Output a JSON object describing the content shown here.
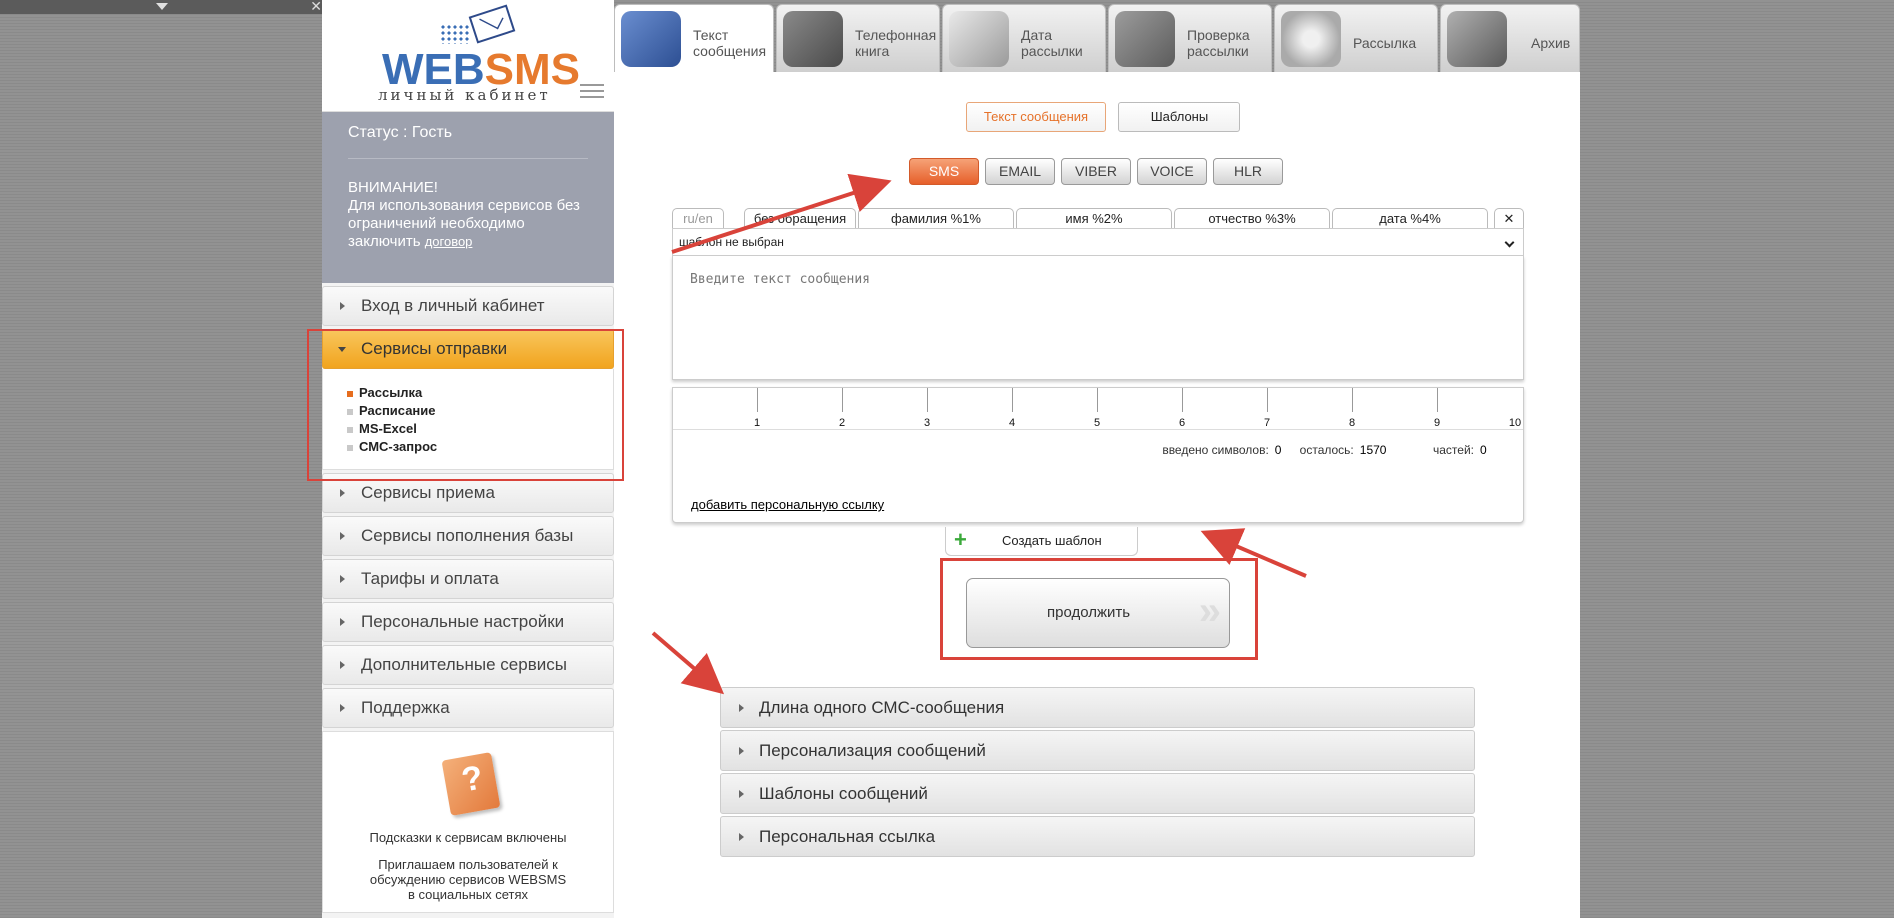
{
  "brand": {
    "logo_web": "WEB",
    "logo_sms": "SMS",
    "subtitle": "личный кабинет"
  },
  "status": {
    "text": "Статус : Гость"
  },
  "notice": {
    "title": "ВНИМАНИЕ!",
    "text": "Для использования сервисов без ограничений необходимо заключить",
    "link": "договор"
  },
  "sidebar": {
    "items": [
      {
        "label": "Вход в личный кабинет"
      },
      {
        "label": "Сервисы отправки"
      },
      {
        "label": "Сервисы приема"
      },
      {
        "label": "Сервисы пополнения базы"
      },
      {
        "label": "Тарифы и оплата"
      },
      {
        "label": "Персональные настройки"
      },
      {
        "label": "Дополнительные сервисы"
      },
      {
        "label": "Поддержка"
      }
    ],
    "submenu": [
      "Рассылка",
      "Расписание",
      "MS-Excel",
      "СМС-запрос"
    ]
  },
  "hints": {
    "enabled": "Подсказки к сервисам включены",
    "invite": "Приглашаем пользователей к обсуждению сервисов WEBSMS в социальных сетях"
  },
  "top_tabs": [
    {
      "label": "Текст сообщения",
      "icon": "keyboard-icon"
    },
    {
      "label": "Телефонная книга",
      "icon": "phone-book-icon"
    },
    {
      "label": "Дата рассылки",
      "icon": "calendar-clock-icon"
    },
    {
      "label": "Проверка рассылки",
      "icon": "price-check-icon"
    },
    {
      "label": "Рассылка",
      "icon": "disc-icon"
    },
    {
      "label": "Архив",
      "icon": "archive-box-icon"
    }
  ],
  "mode_buttons": {
    "text": "Текст сообщения",
    "templates": "Шаблоны"
  },
  "channels": [
    "SMS",
    "EMAIL",
    "VIBER",
    "VOICE",
    "HLR"
  ],
  "variables": {
    "ruen": "ru/en",
    "tabs": [
      "без обращения",
      "фамилия %1%",
      "имя %2%",
      "отчество %3%",
      "дата %4%"
    ],
    "close": "✕"
  },
  "template_select": {
    "value": "шаблон не выбран"
  },
  "message": {
    "placeholder": "Введите текст сообщения"
  },
  "ruler": [
    "1",
    "2",
    "3",
    "4",
    "5",
    "6",
    "7",
    "8",
    "9",
    "10"
  ],
  "counters": {
    "entered_label": "введено символов:",
    "entered": "0",
    "left_label": "осталось:",
    "left": "1570",
    "parts_label": "частей:",
    "parts": "0"
  },
  "personal_link": "добавить персональную ссылку",
  "create_template": {
    "plus": "+",
    "label": "Создать шаблон"
  },
  "continue": {
    "label": "продолжить",
    "chevrons": "»"
  },
  "accordion": [
    "Длина одного СМС-сообщения",
    "Персонализация сообщений",
    "Шаблоны сообщений",
    "Персональная ссылка"
  ],
  "colors": {
    "accent": "#e66d1e",
    "annotation": "#d9433a",
    "active_menu": "#f1a41e"
  }
}
